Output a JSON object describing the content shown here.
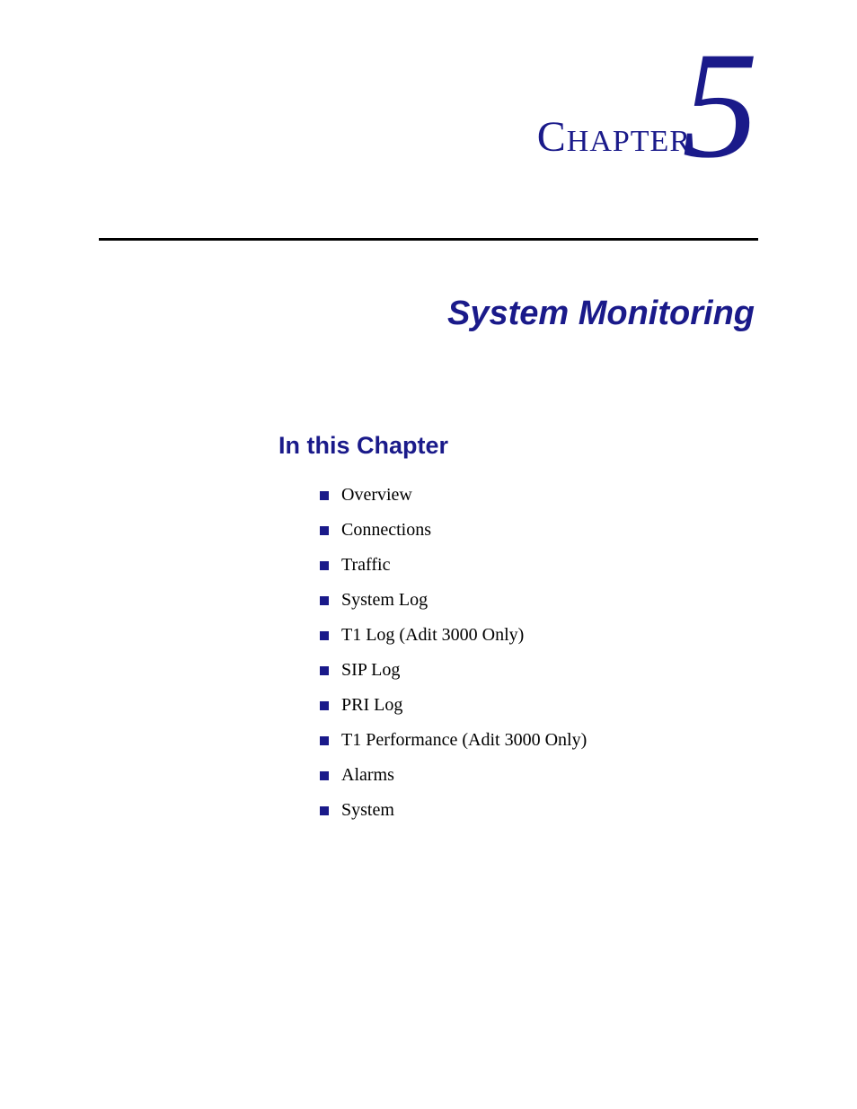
{
  "header": {
    "chapter_word": "Chapter",
    "chapter_number": "5"
  },
  "title": "System Monitoring",
  "section": {
    "heading": "In this Chapter",
    "items": [
      "Overview",
      "Connections",
      "Traffic",
      "System Log",
      "T1 Log (Adit 3000 Only)",
      "SIP Log",
      "PRI Log",
      "T1 Performance (Adit 3000 Only)",
      "Alarms",
      "System"
    ]
  }
}
